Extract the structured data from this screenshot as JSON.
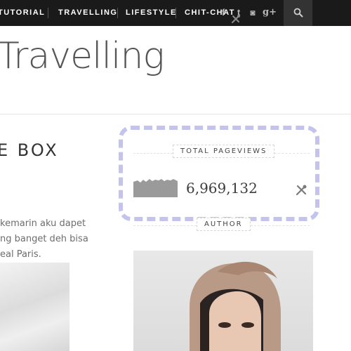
{
  "nav": {
    "items": [
      {
        "label": "TUTORIAL"
      },
      {
        "label": "TRAVELLING"
      },
      {
        "label": "LIFESTYLE"
      },
      {
        "label": "CHIT-CHAT"
      }
    ],
    "social": [
      {
        "icon": "facebook-icon",
        "glyph": "f"
      },
      {
        "icon": "twitter-icon",
        "glyph": "t"
      },
      {
        "icon": "instagram-icon",
        "glyph": "◙"
      },
      {
        "icon": "google-plus-icon",
        "glyph": "g+"
      }
    ]
  },
  "page": {
    "title": "Travelling"
  },
  "post": {
    "title": "E BOX",
    "lines": [
      "kemarin aku dapet",
      "ng banget deh bisa",
      "eal Paris."
    ]
  },
  "widgets": {
    "pageviews_label": "TOTAL PAGEVIEWS",
    "pageviews_count": "6,969,132",
    "author_label": "AUTHOR"
  },
  "colors": {
    "nav_bg": "#1a1a1a",
    "highlight_dash": "#c3c3ee"
  }
}
